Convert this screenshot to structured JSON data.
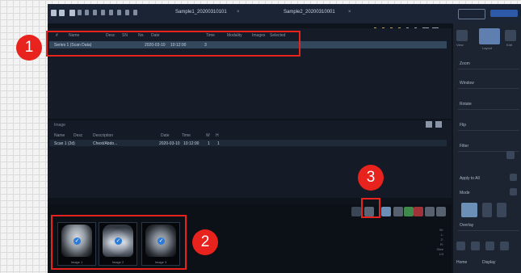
{
  "topbar": {
    "tabs": [
      {
        "label": "Sample1_20200310101",
        "close": "×"
      },
      {
        "label": "Sample2_20200310001",
        "close": "×"
      }
    ]
  },
  "series_table": {
    "headers": [
      "#",
      "Name",
      "Desc",
      "SN",
      "No.",
      "Date",
      "Time",
      "Modality",
      "Images",
      "Selected"
    ],
    "rows": [
      {
        "name": "Series 1 (Scan Data)",
        "date": "2020-03-10",
        "time": "10:12:00",
        "images": "3"
      }
    ]
  },
  "lower_list": {
    "title": "Image",
    "headers": [
      "Name",
      "Desc",
      "Description",
      "Date",
      "Time",
      "W",
      "H"
    ],
    "rows": [
      {
        "name": "Scan 1 (2d)",
        "desc": "Chest/Abdo...",
        "date": "2020-03-10",
        "time": "10:12:00",
        "w": "1",
        "h": "1"
      }
    ]
  },
  "thumbnails": [
    {
      "label": "Image 1",
      "checked": "✓"
    },
    {
      "label": "Image 2",
      "checked": "✓"
    },
    {
      "label": "Image 3",
      "checked": "✓"
    }
  ],
  "right_panel": {
    "tab_labels": [
      "View",
      "Layout",
      "Edit"
    ],
    "rows": [
      "Zoom",
      "Window",
      "Rotate",
      "Flip",
      "Filter",
      "Apply to All",
      "Mode",
      "Overlay"
    ],
    "bottom": [
      "Home",
      "Display"
    ]
  },
  "info_lines": [
    "W:",
    "L:",
    "Z:",
    "R:",
    "Slice",
    "1/3"
  ],
  "callouts": [
    "1",
    "2",
    "3"
  ]
}
